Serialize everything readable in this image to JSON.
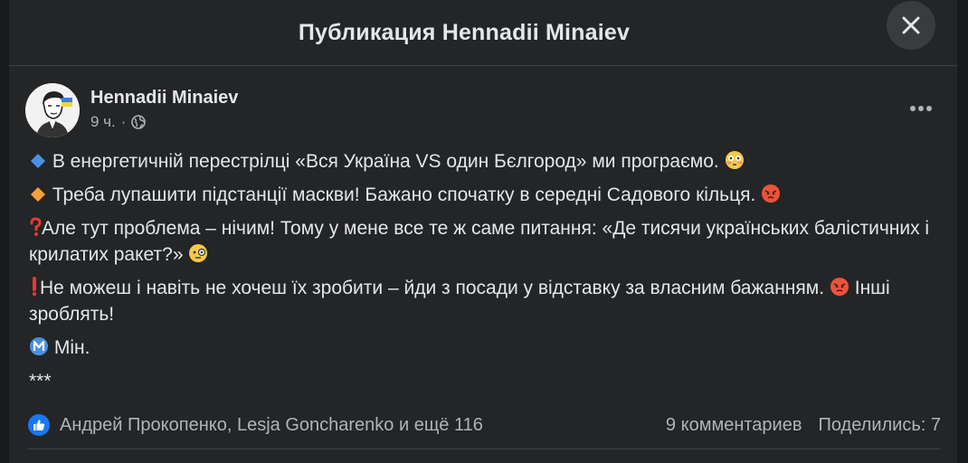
{
  "modal": {
    "title": "Публикация Hennadii Minaiev"
  },
  "post": {
    "author": "Hennadii Minaiev",
    "time": "9 ч.",
    "separator": "·",
    "paragraphs": [
      {
        "emoji": "small-blue-diamond",
        "text": "В енергетичній перестрілці «Вся Україна VS один Бєлгород» ми програємо.",
        "end_emoji": "flushed-face"
      },
      {
        "emoji": "small-orange-diamond",
        "text": "Треба лупашити підстанції маскви! Бажано спочатку в середні Садового кільця.",
        "end_emoji": "angry-face"
      },
      {
        "emoji": "red-question-mark",
        "text": "Але тут проблема – нічим! Тому у мене все те ж саме питання: «Де тисячи українських балістичних і крилатих ракет?»",
        "end_emoji": "face-with-monocle"
      },
      {
        "emoji": "red-exclamation-mark",
        "text_a": "Не можеш і навіть не хочеш їх зробити – йди з посади у відставку за власним бажанням.",
        "mid_emoji": "angry-face",
        "text_b": "Інші зроблять!"
      },
      {
        "emoji": "circled-m",
        "text": "Мін."
      },
      {
        "text": "***"
      }
    ]
  },
  "stats": {
    "reactions_text": "Андрей Прокопенко, Lesja Goncharenko и ещё 116",
    "comments": "9 комментариев",
    "shares": "Поделились: 7"
  },
  "icons": {
    "close": "close-icon",
    "globe": "globe-icon",
    "more": "more-options-icon",
    "like": "like-reaction-icon"
  },
  "colors": {
    "background": "#18191a",
    "card": "#242526",
    "text": "#e4e6eb",
    "secondary_text": "#b0b3b8",
    "like_blue": "#1877f2"
  }
}
